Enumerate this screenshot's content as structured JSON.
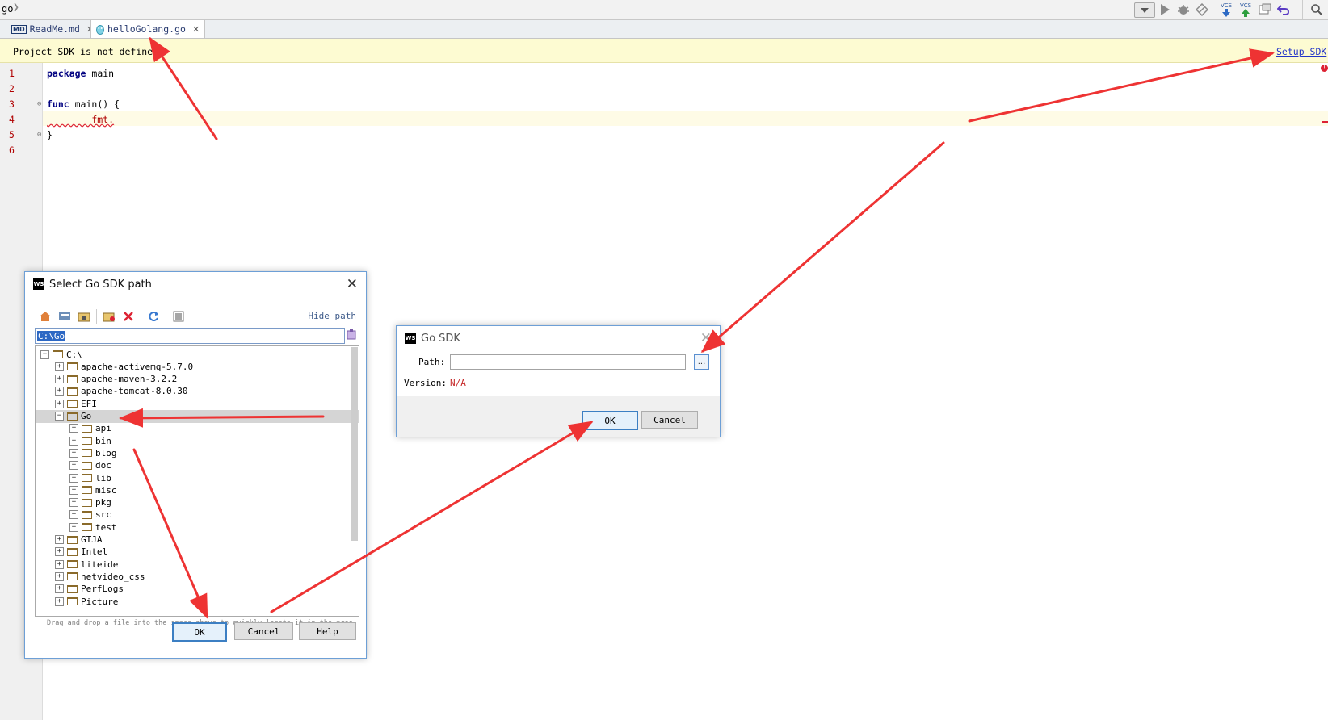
{
  "breadcrumb": {
    "project": "go",
    "separator": "❯"
  },
  "toolbar": {
    "icons": [
      "dropdown-arrow-icon",
      "run-icon",
      "debug-icon",
      "coverage-icon",
      "vcs-update-icon",
      "vcs-commit-icon",
      "vcs-history-icon",
      "revert-icon",
      "search-icon"
    ],
    "vcs_label": "VCS"
  },
  "tabs": [
    {
      "label": "ReadMe.md",
      "icon": "markdown-icon",
      "icon_text": "MD",
      "active": false
    },
    {
      "label": "helloGolang.go",
      "icon": "go-gopher-icon",
      "active": true
    }
  ],
  "tab_close": "✕",
  "notice": {
    "text": "Project SDK is not defined",
    "link": "Setup SDK"
  },
  "editor": {
    "lines": [
      {
        "n": "1",
        "tokens": [
          {
            "t": "package",
            "kw": true
          },
          {
            "t": " main",
            "kw": false
          }
        ]
      },
      {
        "n": "2",
        "tokens": []
      },
      {
        "n": "3",
        "tokens": [
          {
            "t": "func",
            "kw": true
          },
          {
            "t": " main() {",
            "kw": false
          }
        ]
      },
      {
        "n": "4",
        "tokens": [
          {
            "t": "        fmt.",
            "kw": false,
            "err": true
          }
        ]
      },
      {
        "n": "5",
        "tokens": [
          {
            "t": "}",
            "kw": false
          }
        ]
      },
      {
        "n": "6",
        "tokens": []
      }
    ],
    "error_mark": "!"
  },
  "select_dialog": {
    "logo": "WS",
    "title": "Select Go SDK path",
    "hide_path": "Hide path",
    "path_value": "C:\\Go",
    "tree": [
      {
        "label": "C:\\",
        "depth": 0,
        "expanded": true
      },
      {
        "label": "apache-activemq-5.7.0",
        "depth": 1
      },
      {
        "label": "apache-maven-3.2.2",
        "depth": 1
      },
      {
        "label": "apache-tomcat-8.0.30",
        "depth": 1
      },
      {
        "label": "EFI",
        "depth": 1
      },
      {
        "label": "Go",
        "depth": 1,
        "expanded": true,
        "selected": true
      },
      {
        "label": "api",
        "depth": 2
      },
      {
        "label": "bin",
        "depth": 2
      },
      {
        "label": "blog",
        "depth": 2
      },
      {
        "label": "doc",
        "depth": 2
      },
      {
        "label": "lib",
        "depth": 2
      },
      {
        "label": "misc",
        "depth": 2
      },
      {
        "label": "pkg",
        "depth": 2
      },
      {
        "label": "src",
        "depth": 2
      },
      {
        "label": "test",
        "depth": 2
      },
      {
        "label": "GTJA",
        "depth": 1
      },
      {
        "label": "Intel",
        "depth": 1
      },
      {
        "label": "liteide",
        "depth": 1
      },
      {
        "label": "netvideo_css",
        "depth": 1
      },
      {
        "label": "PerfLogs",
        "depth": 1
      },
      {
        "label": "Picture",
        "depth": 1
      }
    ],
    "drop_hint": "Drag and drop a file into the space above to quickly locate it in the tree",
    "buttons": {
      "ok": "OK",
      "cancel": "Cancel",
      "help": "Help"
    }
  },
  "go_sdk_dialog": {
    "logo": "WS",
    "title": "Go SDK",
    "path_label": "Path:",
    "path_value": "",
    "browse": "...",
    "version_label": "Version:",
    "version_value": "N/A",
    "buttons": {
      "ok": "OK",
      "cancel": "Cancel"
    }
  },
  "colors": {
    "notice_bg": "#fdfbd2",
    "link": "#2335c8",
    "keyword": "#000080",
    "line_number": "#b00000",
    "annotation_arrow": "#ee3333",
    "selection": "#2d68c4"
  }
}
